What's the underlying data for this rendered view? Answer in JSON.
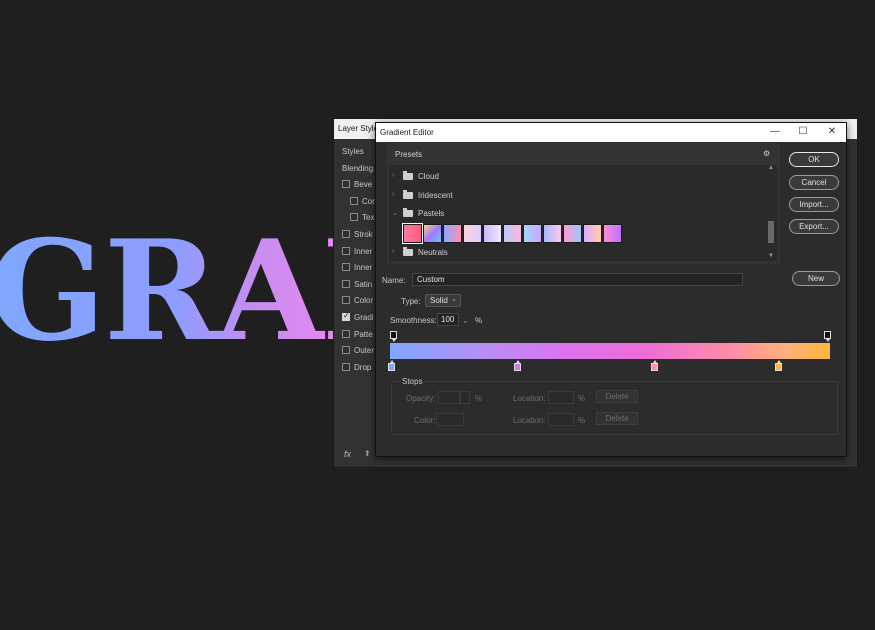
{
  "canvas": {
    "text": "GRAI"
  },
  "layer_style": {
    "title": "Layer Style",
    "items": [
      {
        "label": "Styles",
        "checkbox": false,
        "checked": false
      },
      {
        "label": "Blending",
        "checkbox": false,
        "checked": false
      },
      {
        "label": "Beve",
        "checkbox": true,
        "checked": false
      },
      {
        "label": "Cor",
        "checkbox": true,
        "checked": false
      },
      {
        "label": "Tex",
        "checkbox": true,
        "checked": false
      },
      {
        "label": "Strok",
        "checkbox": true,
        "checked": false
      },
      {
        "label": "Inner",
        "checkbox": true,
        "checked": false
      },
      {
        "label": "Inner",
        "checkbox": true,
        "checked": false
      },
      {
        "label": "Satin",
        "checkbox": true,
        "checked": false
      },
      {
        "label": "Color",
        "checkbox": true,
        "checked": false
      },
      {
        "label": "Gradi",
        "checkbox": true,
        "checked": true
      },
      {
        "label": "Patte",
        "checkbox": true,
        "checked": false
      },
      {
        "label": "Outer",
        "checkbox": true,
        "checked": false
      },
      {
        "label": "Drop",
        "checkbox": true,
        "checked": false
      }
    ],
    "fx_label": "fx"
  },
  "gradient_editor": {
    "title": "Gradient Editor",
    "window_controls": {
      "minimize": "—",
      "maximize": "☐",
      "close": "✕"
    },
    "presets": {
      "label": "Presets",
      "gear_icon": "⚙",
      "folders": [
        {
          "name": "Cloud",
          "expanded": false
        },
        {
          "name": "Iridescent",
          "expanded": false
        },
        {
          "name": "Pastels",
          "expanded": true
        },
        {
          "name": "Neutrals",
          "expanded": false
        }
      ],
      "swatches": [
        "linear-gradient(90deg,#ff7aa0,#ff5a7a)",
        "linear-gradient(135deg,#ffd36e,#a07aff,#6ec0ff)",
        "linear-gradient(90deg,#8fa8ff,#ff8fb5)",
        "linear-gradient(90deg,#ffd1dc,#d8d0ff)",
        "linear-gradient(90deg,#c9b8ff,#f3e8ff)",
        "linear-gradient(90deg,#b8c8ff,#ffb8d8)",
        "linear-gradient(90deg,#9fd8ff,#c8a8ff)",
        "linear-gradient(90deg,#a8b8ff,#ffc8e8)",
        "linear-gradient(90deg,#ff9ad0,#9ac8ff)",
        "linear-gradient(90deg,#e0a8ff,#ffd0a8)",
        "linear-gradient(90deg,#ff8ad8,#c070ff)"
      ]
    },
    "buttons": {
      "ok": "OK",
      "cancel": "Cancel",
      "import": "Import...",
      "export": "Export...",
      "new": "New"
    },
    "name": {
      "label": "Name:",
      "value": "Custom"
    },
    "type": {
      "label": "Type:",
      "value": "Solid"
    },
    "smoothness": {
      "label": "Smoothness:",
      "value": "100",
      "unit": "%"
    },
    "gradient": {
      "colors": [
        "#7fa7ff",
        "#dd72f0",
        "#ff8ea6",
        "#ffb43e"
      ],
      "color_stops": [
        {
          "location": 0,
          "color": "#7fa7ff"
        },
        {
          "location": 29,
          "color": "#dd72f0"
        },
        {
          "location": 60,
          "color": "#ff8ea6"
        },
        {
          "location": 88,
          "color": "#ffb43e"
        }
      ],
      "opacity_stops": [
        0,
        100
      ]
    },
    "stops": {
      "label": "Stops",
      "opacity_label": "Opacity:",
      "percent": "%",
      "location_label": "Location:",
      "delete_label": "Delete",
      "color_label": "Color:"
    }
  }
}
